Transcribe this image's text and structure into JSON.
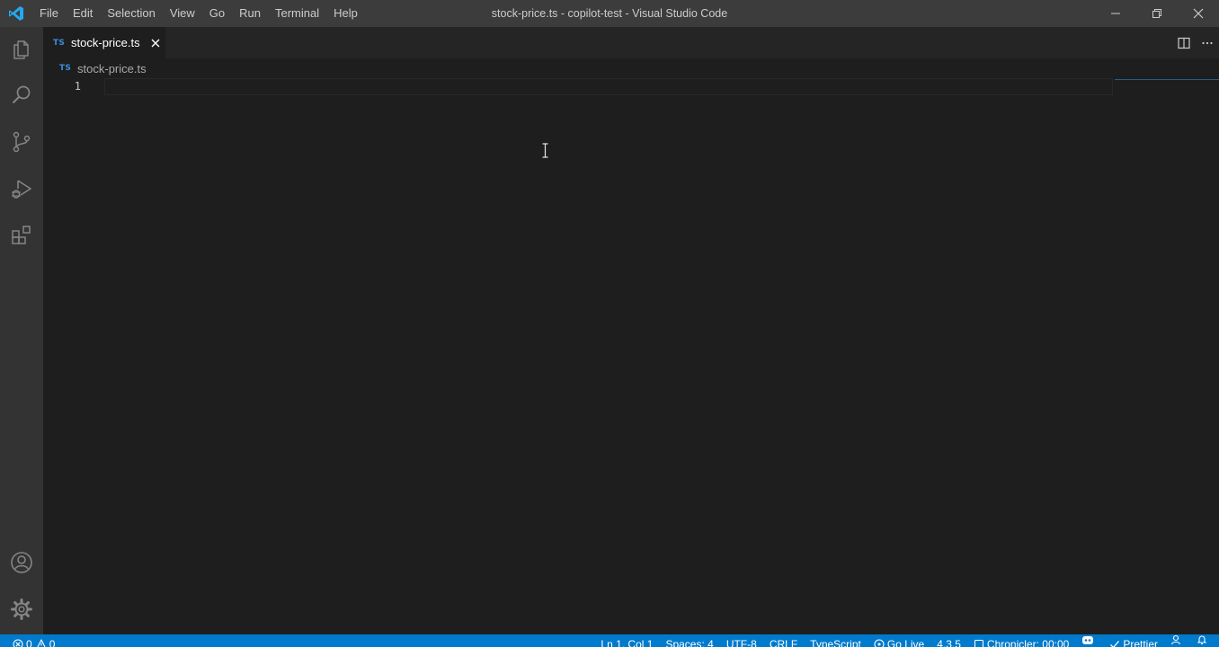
{
  "window": {
    "title": "stock-price.ts - copilot-test - Visual Studio Code"
  },
  "menu": [
    "File",
    "Edit",
    "Selection",
    "View",
    "Go",
    "Run",
    "Terminal",
    "Help"
  ],
  "tab": {
    "badge": "TS",
    "label": "stock-price.ts"
  },
  "breadcrumb": {
    "badge": "TS",
    "label": "stock-price.ts"
  },
  "editor": {
    "line_number": "1"
  },
  "status": {
    "errors": "0",
    "warnings": "0",
    "position": "Ln 1, Col 1",
    "spaces": "Spaces: 4",
    "encoding": "UTF-8",
    "eol": "CRLF",
    "language": "TypeScript",
    "go_live": "Go Live",
    "version": "4.3.5",
    "chronicler": "Chronicler: 00:00",
    "prettier": "Prettier"
  },
  "icons": {
    "activity": [
      "files-icon",
      "search-icon",
      "source-control-icon",
      "run-debug-icon",
      "extensions-icon",
      "account-icon",
      "settings-gear-icon"
    ]
  },
  "colors": {
    "accent": "#007acc",
    "ts_badge": "#3c8cdc",
    "titlebar": "#3c3c3c",
    "activitybar": "#333333",
    "editor_bg": "#1e1e1e"
  }
}
